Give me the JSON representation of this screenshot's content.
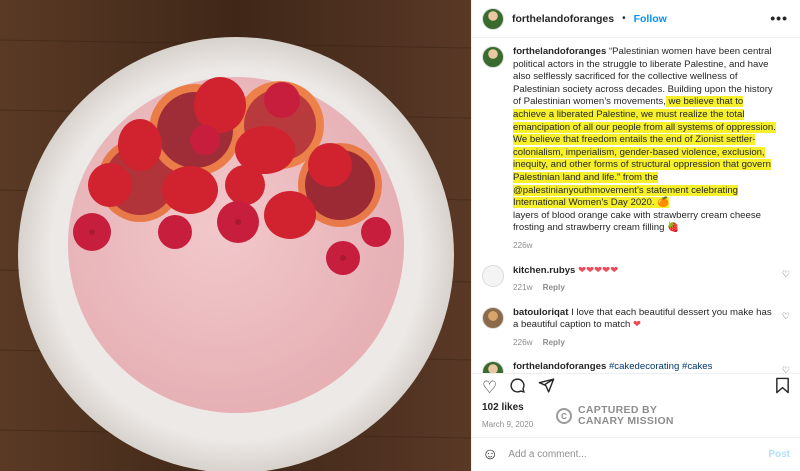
{
  "header": {
    "username": "forthelandoforanges",
    "separator": "•",
    "follow_label": "Follow",
    "more_icon": "more-icon"
  },
  "caption": {
    "username": "forthelandoforanges",
    "text_before": " “Palestinian women have been central political actors in the struggle to liberate Palestine, and have also selflessly sacrificed for the collective wellness of Palestinian society across decades. Building upon the history of Palestinian women’s movements,",
    "text_highlight": " we believe that to achieve a liberated Palestine, we must realize the total emancipation of all our people from all systems of oppression. We believe that freedom entails the end of Zionist settler-colonialism, imperialism, gender-based violence, exclusion, inequity, and other forms of structural oppression that govern Palestinian land and life.” from the @palestinianyouthmovement’s statement celebrating International Women’s Day 2020. ",
    "emoji_highlight": "🍊",
    "text_after": "layers of blood orange cake with strawberry cream cheese frosting and strawberry cream filling ",
    "emoji_after": "🍓",
    "time": "226w"
  },
  "comments": [
    {
      "username": "kitchen.rubys",
      "text": "❤❤❤❤❤",
      "time": "221w",
      "reply": "Reply"
    },
    {
      "username": "batouloriqat",
      "text": " I love that each beautiful dessert you make has a beautiful caption to match ",
      "emoji": "❤",
      "time": "226w",
      "reply": "Reply"
    },
    {
      "username": "forthelandoforanges",
      "tags": "#cakedecorating #cakes #cakesofinstagram #palestine #palestinerscake #aprilisforarabfood"
    }
  ],
  "likes": "102 likes",
  "date": "March 9, 2020",
  "watermark": {
    "line1": "CAPTURED BY",
    "line2": "CANARY MISSION"
  },
  "add_comment": {
    "placeholder": "Add a comment...",
    "post_label": "Post"
  }
}
